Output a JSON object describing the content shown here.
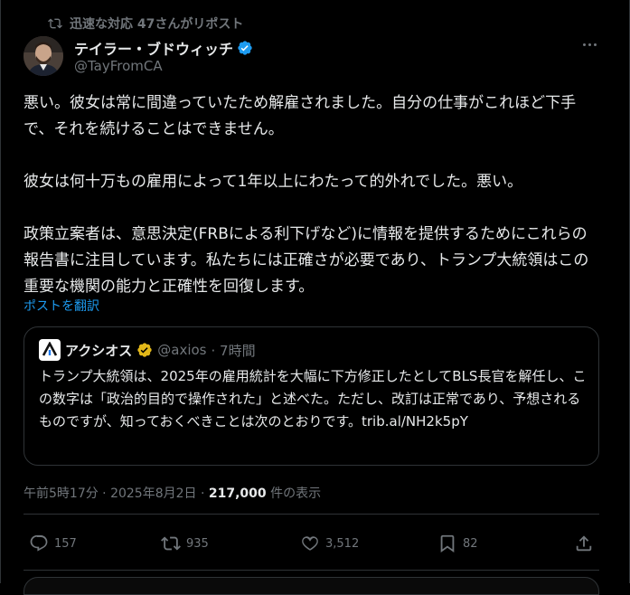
{
  "repost": {
    "text": "迅速な対応 47さんがリポスト",
    "icon": "repost-icon"
  },
  "author": {
    "name": "テイラー・ブドウィッチ",
    "handle": "@TayFromCA",
    "verified_color": "#1d9bf0"
  },
  "post": {
    "paragraphs": [
      "悪い。彼女は常に間違っていたため解雇されました。自分の仕事がこれほど下手で、それを続けることはできません。",
      "彼女は何十万もの雇用によって1年以上にわたって的外れでした。悪い。",
      "政策立案者は、意思決定(FRBによる利下げなど)に情報を提供するためにこれらの報告書に注目しています。私たちには正確さが必要であり、トランプ大統領はこの重要な機関の能力と正確性を回復します。"
    ],
    "translate_label": "ポストを翻訳"
  },
  "quote": {
    "name": "アクシオス",
    "handle": "@axios",
    "time": "· 7時間",
    "text": "トランプ大統領は、2025年の雇用統計を大幅に下方修正したとしてBLS長官を解任し、この数字は「政治的目的で操作された」と述べた。ただし、改訂は正常であり、予想されるものですが、知っておくべきことは次のとおりです。trib.al/NH2k5pY",
    "badge_color": "#e2b719"
  },
  "meta": {
    "time": "午前5時17分 · 2025年8月2日 · ",
    "views": "217,000",
    "views_label": " 件の表示"
  },
  "actions": {
    "replies": "157",
    "reposts": "935",
    "likes": "3,512",
    "bookmarks": "82"
  },
  "colors": {
    "accent": "#1d9bf0",
    "muted": "#71767b",
    "text": "#e7e9ea",
    "background": "#000000"
  }
}
